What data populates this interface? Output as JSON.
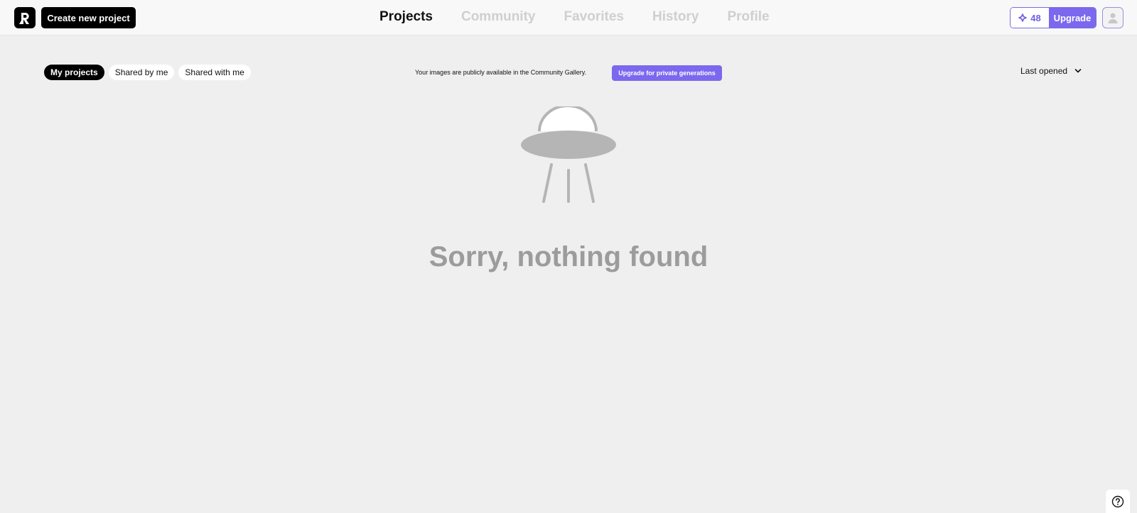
{
  "header": {
    "logo_icon": "app-logo-R",
    "create_button": "Create new project",
    "nav": [
      {
        "label": "Projects",
        "active": true
      },
      {
        "label": "Community",
        "active": false
      },
      {
        "label": "Favorites",
        "active": false
      },
      {
        "label": "History",
        "active": false
      },
      {
        "label": "Profile",
        "active": false
      }
    ],
    "credits": {
      "icon": "sparkle-diamond-icon",
      "count": "48"
    },
    "upgrade_button": "Upgrade",
    "avatar_icon": "user-icon"
  },
  "filters": {
    "tabs": [
      {
        "label": "My projects",
        "active": true
      },
      {
        "label": "Shared by me",
        "active": false
      },
      {
        "label": "Shared with me",
        "active": false
      }
    ]
  },
  "notice": {
    "text": "Your images are publicly available in the Community Gallery.",
    "button": "Upgrade for private generations"
  },
  "sort": {
    "selected": "Last opened",
    "icon": "chevron-down-icon"
  },
  "empty_state": {
    "illustration": "ufo-icon",
    "message": "Sorry, nothing found"
  },
  "help": {
    "icon": "question-circle-icon"
  },
  "colors": {
    "accent": "#7b68ee",
    "background": "#efefef",
    "header_bg": "#f8f8f8",
    "muted_text": "#9c9c9c",
    "inactive_nav": "#cfcfcf"
  }
}
